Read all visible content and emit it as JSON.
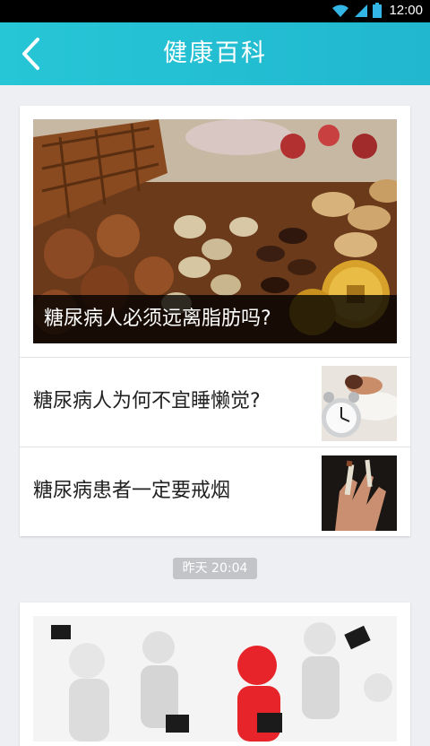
{
  "status_bar": {
    "time": "12:00",
    "icons": [
      "wifi-icon",
      "signal-icon",
      "battery-icon"
    ]
  },
  "app_bar": {
    "title": "健康百科",
    "back_icon": "chevron-left-icon",
    "color": "#26c6d6"
  },
  "feed": [
    {
      "hero": {
        "caption": "糖尿病人必须远离脂肪吗?",
        "image": "nuts-and-coins-photo"
      },
      "items": [
        {
          "title": "糖尿病人为何不宜睡懒觉?",
          "thumb": "alarm-clock-sleeping-photo"
        },
        {
          "title": "糖尿病患者一定要戒烟",
          "thumb": "cigarette-hand-photo"
        }
      ]
    },
    {
      "time": "昨天  20:04",
      "hero": {
        "image": "business-figures-illustration"
      }
    }
  ]
}
